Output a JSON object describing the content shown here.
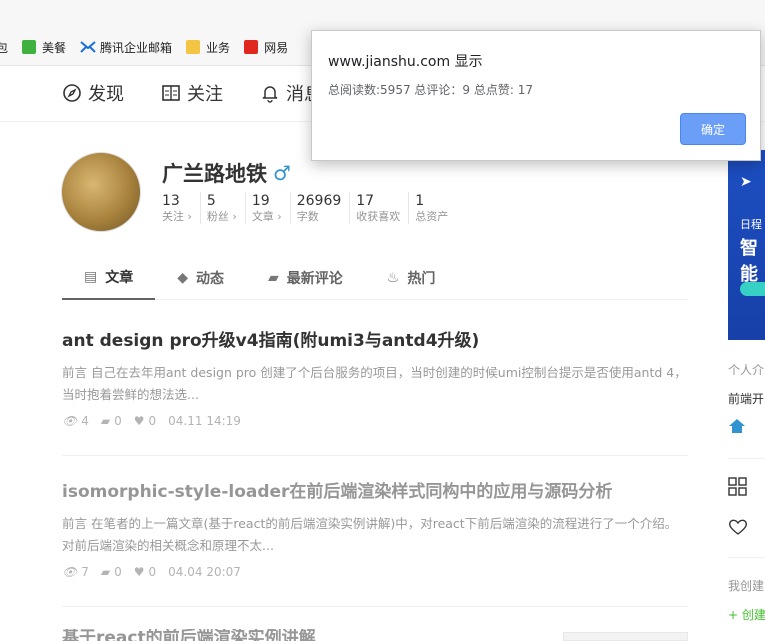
{
  "bookmarks": [
    {
      "label": "包",
      "icon": "folder-icon"
    },
    {
      "label": "美餐",
      "icon": "meican-icon",
      "color": "#3fb13f"
    },
    {
      "label": "腾讯企业邮箱",
      "icon": "tencent-mail-icon",
      "color": "#1a6fd8"
    },
    {
      "label": "业务",
      "icon": "folder-icon",
      "color": "#f4c542"
    },
    {
      "label": "网易",
      "icon": "netease-icon",
      "color": "#e0281f"
    }
  ],
  "nav": {
    "discover": "发现",
    "follow": "关注",
    "messages": "消息"
  },
  "profile": {
    "name": "广兰路地铁",
    "gender_symbol": "♂",
    "stats": [
      {
        "value": "13",
        "label": "关注 ›"
      },
      {
        "value": "5",
        "label": "粉丝 ›"
      },
      {
        "value": "19",
        "label": "文章 ›"
      },
      {
        "value": "26969",
        "label": "字数"
      },
      {
        "value": "17",
        "label": "收获喜欢"
      },
      {
        "value": "1",
        "label": "总资产"
      }
    ]
  },
  "tabs": [
    {
      "label": "文章",
      "icon": "article-icon"
    },
    {
      "label": "动态",
      "icon": "activity-icon"
    },
    {
      "label": "最新评论",
      "icon": "comment-icon"
    },
    {
      "label": "热门",
      "icon": "fire-icon"
    }
  ],
  "articles": [
    {
      "title": "ant design pro升级v4指南(附umi3与antd4升级)",
      "abstract": "前言 自己在去年用ant design pro 创建了个后台服务的项目，当时创建的时候umi控制台提示是否使用antd 4，当时抱着尝鲜的想法选...",
      "views": "4",
      "comments": "0",
      "likes": "0",
      "date": "04.11 14:19"
    },
    {
      "title": "isomorphic-style-loader在前后端渲染样式同构中的应用与源码分析",
      "abstract": "前言 在笔者的上一篇文章(基于react的前后端渲染实例讲解)中，对react下前后端渲染的流程进行了一个介绍。对前后端渲染的相关概念和原理不太...",
      "views": "7",
      "comments": "0",
      "likes": "0",
      "date": "04.04 20:07"
    },
    {
      "title": "基于react的前后端渲染实例讲解"
    }
  ],
  "sidebar": {
    "ad_line1": "日程",
    "ad_line2": "智能",
    "intro_label": "个人介",
    "intro_text": "前端开",
    "my_label": "我创建",
    "create_label": "+ 创建"
  },
  "dialog": {
    "title": "www.jianshu.com 显示",
    "message": "总阅读数:5957 总评论：9 总点赞: 17",
    "ok_label": "确定"
  }
}
